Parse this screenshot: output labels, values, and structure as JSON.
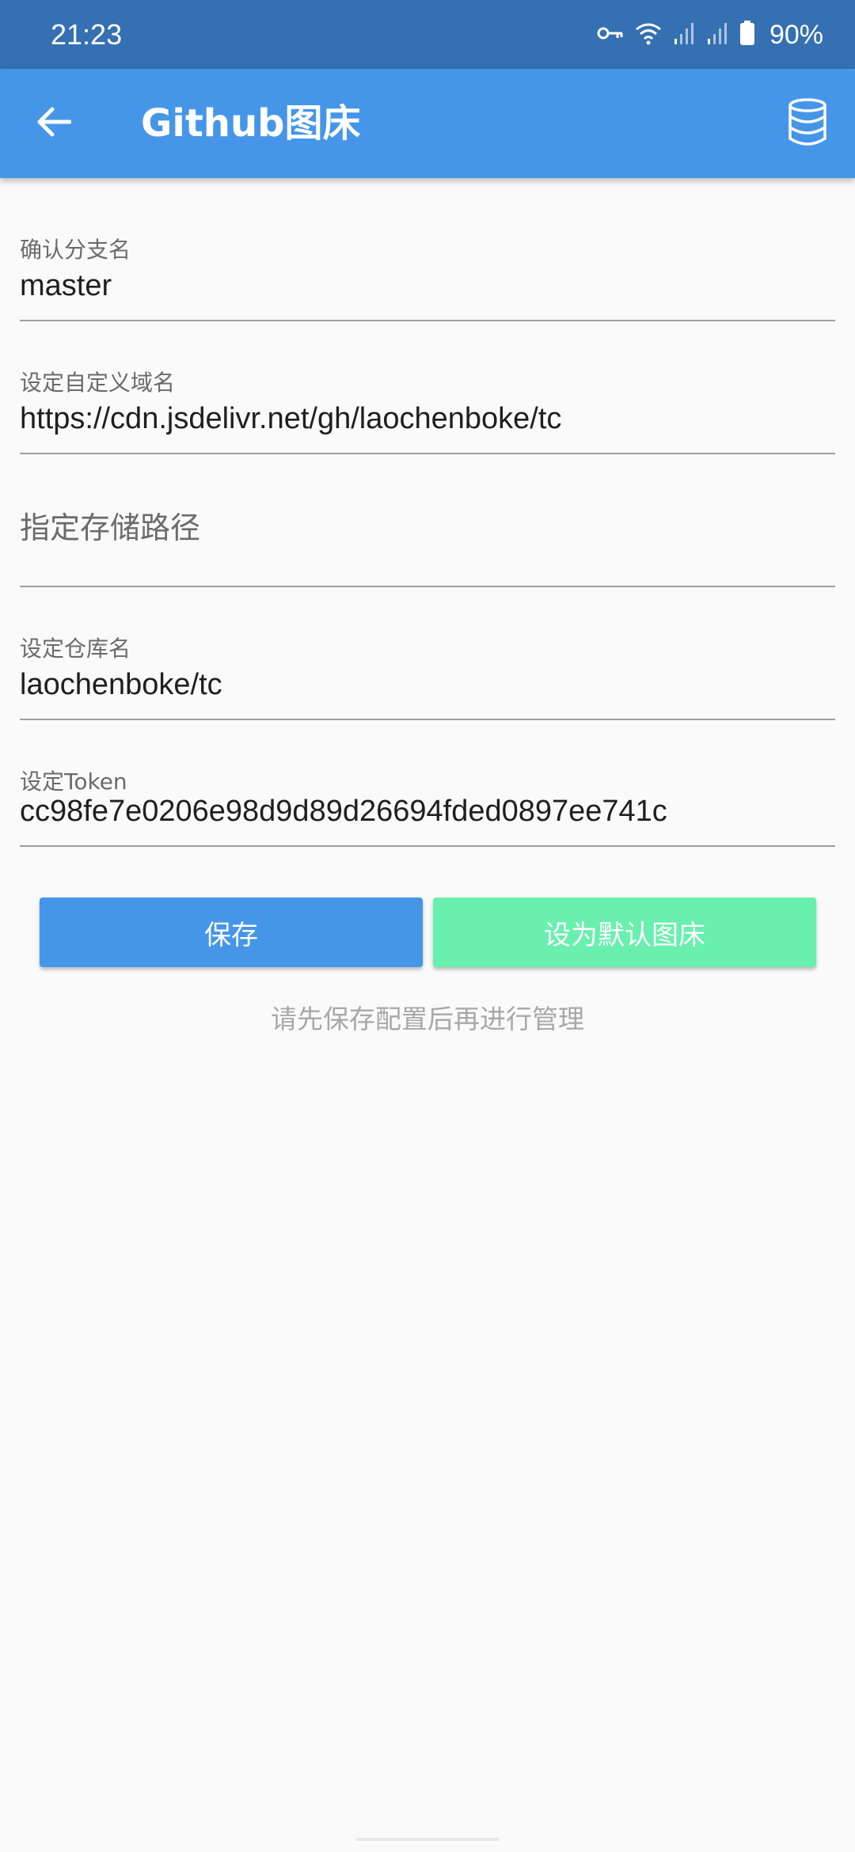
{
  "status_bar": {
    "time": "21:23",
    "battery_text": "90%",
    "icons": [
      "vpn-key-icon",
      "wifi-icon",
      "signal-icon",
      "signal-icon",
      "battery-icon"
    ]
  },
  "app_bar": {
    "title": "Github图床",
    "back_icon": "arrow-back-icon",
    "action_icon": "database-icon"
  },
  "form": {
    "branch": {
      "label": "确认分支名",
      "value": "master"
    },
    "domain": {
      "label": "设定自定义域名",
      "value": "https://cdn.jsdelivr.net/gh/laochenboke/tc"
    },
    "path": {
      "placeholder": "指定存储路径"
    },
    "repo": {
      "label": "设定仓库名",
      "value": "laochenboke/tc"
    },
    "token": {
      "label": "设定Token",
      "value": "cc98fe7e0206e98d9d89d26694fded0897ee741c"
    }
  },
  "buttons": {
    "save": "保存",
    "set_default": "设为默认图床"
  },
  "hint": "请先保存配置后再进行管理",
  "colors": {
    "status_bar": "#3470B2",
    "app_bar": "#4596E9",
    "primary_button": "#4596E9",
    "secondary_button": "#69F0AE",
    "background": "#FAFAFA"
  }
}
